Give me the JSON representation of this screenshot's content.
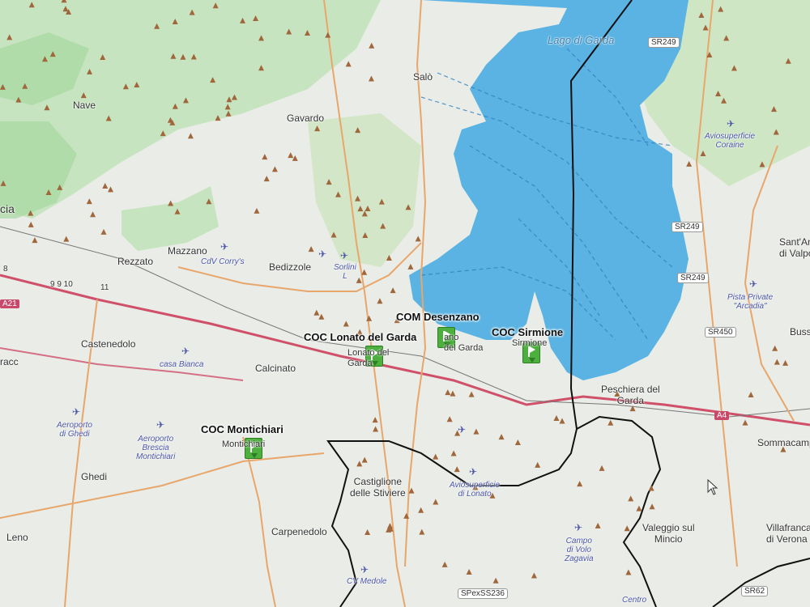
{
  "map": {
    "water_name": "Lago di Garda",
    "places": [
      {
        "id": "nave",
        "name": "Nave"
      },
      {
        "id": "gavardo",
        "name": "Gavardo"
      },
      {
        "id": "salo",
        "name": "Salò"
      },
      {
        "id": "mazzano",
        "name": "Mazzano"
      },
      {
        "id": "rezzato",
        "name": "Rezzato"
      },
      {
        "id": "bedizzole",
        "name": "Bedizzole"
      },
      {
        "id": "castenedolo",
        "name": "Castenedolo"
      },
      {
        "id": "calcinato",
        "name": "Calcinato"
      },
      {
        "id": "ghedi",
        "name": "Ghedi"
      },
      {
        "id": "leno",
        "name": "Leno"
      },
      {
        "id": "carpenedolo",
        "name": "Carpenedolo"
      },
      {
        "id": "castiglione",
        "name": "Castiglione\ndelle Stiviere"
      },
      {
        "id": "peschiera",
        "name": "Peschiera del\nGarda"
      },
      {
        "id": "valeggio",
        "name": "Valeggio sul\nMincio"
      },
      {
        "id": "villafranca",
        "name": "Villafranca\ndi Verona"
      },
      {
        "id": "sommacampagna",
        "name": "Sommacampa"
      },
      {
        "id": "santambrogio",
        "name": "Sant'Am\ndi Valpo"
      },
      {
        "id": "bussolengo",
        "name": "Busso"
      },
      {
        "id": "brescia",
        "name": "cia"
      },
      {
        "id": "bracc",
        "name": "racc"
      }
    ],
    "airfields": [
      {
        "id": "cdv-corrys",
        "name": "CdV Corry's"
      },
      {
        "id": "sorlini",
        "name": "Sorlini\nL"
      },
      {
        "id": "casa-bianca",
        "name": "casa Bianca"
      },
      {
        "id": "aeroporto-ghedi",
        "name": "Aeroporto\ndi Ghedi"
      },
      {
        "id": "aeroporto-montichiari",
        "name": "Aeroporto\nBrescia\nMontichiari"
      },
      {
        "id": "aviosuperficie-lonato",
        "name": "Aviosuperficie\ndi Lonato"
      },
      {
        "id": "aviosuperficie-coraine",
        "name": "Aviosuperficie\nCoraine"
      },
      {
        "id": "pista-arcadia",
        "name": "Pista Private\n\"Arcadia\""
      },
      {
        "id": "campo-zagavia",
        "name": "Campo\ndi Volo\nZagavia"
      },
      {
        "id": "cv-medole",
        "name": "CV Medole"
      },
      {
        "id": "centro",
        "name": "Centro"
      }
    ],
    "roads": [
      {
        "id": "sr249-top",
        "name": "SR249"
      },
      {
        "id": "sr249-mid",
        "name": "SR249"
      },
      {
        "id": "sr249-low",
        "name": "SR249"
      },
      {
        "id": "sr450",
        "name": "SR450"
      },
      {
        "id": "a4",
        "name": "A4"
      },
      {
        "id": "a21",
        "name": "A21"
      },
      {
        "id": "spex",
        "name": "SPexSS236"
      },
      {
        "id": "sr62",
        "name": "SR62"
      },
      {
        "id": "exit-nums",
        "name": "9 9 10"
      },
      {
        "id": "exit-11",
        "name": "11"
      },
      {
        "id": "exit-8",
        "name": "8"
      }
    ],
    "command_centers": [
      {
        "id": "com-desenzano",
        "title": "COM Desenzano",
        "base_label": "ano\ndel Garda"
      },
      {
        "id": "coc-lonato",
        "title": "COC Lonato del Garda",
        "base_label": "Lonato del\nGarda"
      },
      {
        "id": "coc-sirmione",
        "title": "COC Sirmione",
        "base_label": "Sirmione"
      },
      {
        "id": "coc-montichiari",
        "title": "COC Montichiari",
        "base_label": "Montichiari"
      }
    ],
    "colors": {
      "background": "#e9ece7",
      "lake": "#5ab3e2",
      "hills": "#bfe0b7",
      "boundary": "#111111",
      "motorway": "#d0506a",
      "road": "#e9a66b",
      "peak": "#a0673c",
      "flag": "#4caf3e",
      "airfield": "#4a55a8"
    }
  }
}
